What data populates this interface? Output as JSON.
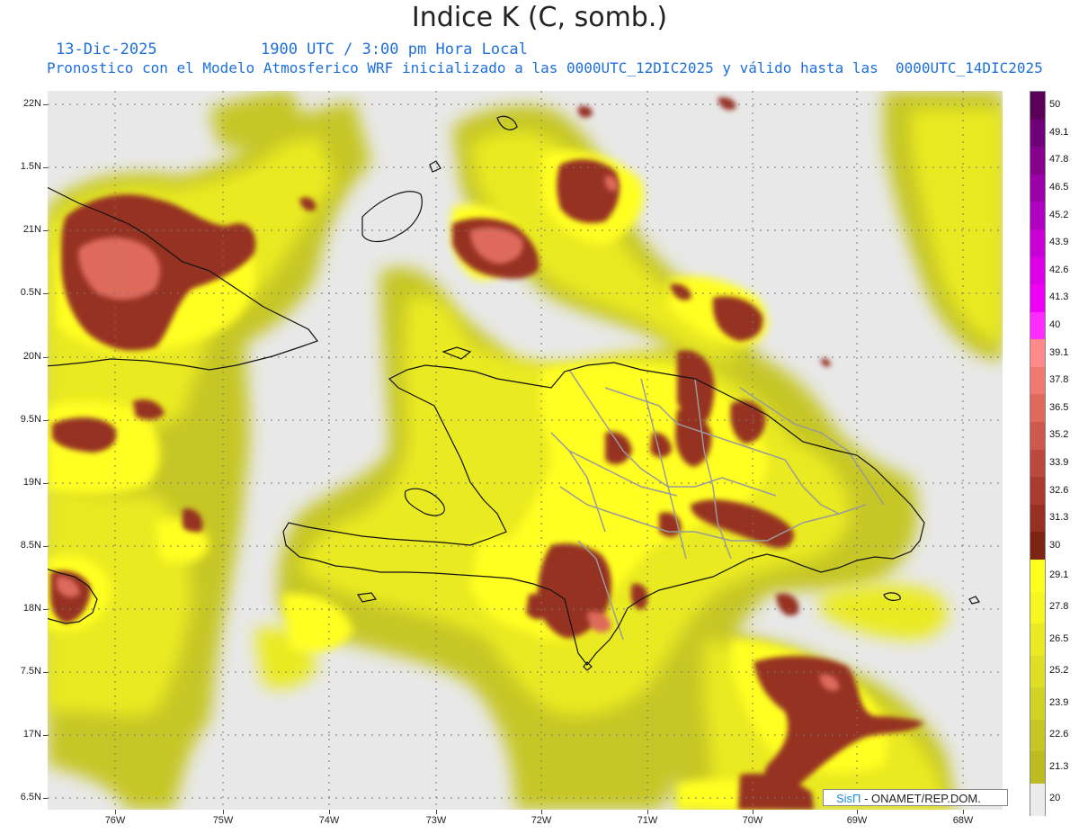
{
  "title": "Indice K (C, somb.)",
  "date": "13-Dic-2025",
  "time": "1900 UTC / 3:00 pm Hora Local",
  "description": "Pronostico con el Modelo Atmosferico WRF inicializado a las 0000UTC_12DIC2025 y válido hasta las  0000UTC_14DIC2025",
  "credit": {
    "brand": "SisΠ",
    "rest": " - ONAMET/REP.DOM."
  },
  "latitude_labels": [
    "22N",
    "1.5N",
    "21N",
    "0.5N",
    "20N",
    "9.5N",
    "19N",
    "8.5N",
    "18N",
    "7.5N",
    "17N",
    "6.5N"
  ],
  "longitude_labels": [
    "76W",
    "75W",
    "74W",
    "73W",
    "72W",
    "71W",
    "70W",
    "69W",
    "68W"
  ],
  "colorbar": {
    "labels": [
      "50",
      "49.1",
      "47.8",
      "46.5",
      "45.2",
      "43.9",
      "42.6",
      "41.3",
      "40",
      "39.1",
      "37.8",
      "36.5",
      "35.2",
      "33.9",
      "32.6",
      "31.3",
      "30",
      "29.1",
      "27.8",
      "26.5",
      "25.2",
      "23.9",
      "22.6",
      "21.3",
      "20"
    ],
    "colors": [
      "#5a005a",
      "#6e0078",
      "#86008e",
      "#9a00a8",
      "#b000c0",
      "#c800d6",
      "#dc00e8",
      "#ee00f4",
      "#ff2cff",
      "#ff8a8a",
      "#ee7a70",
      "#de6a5c",
      "#cc5a4c",
      "#ba4a3e",
      "#a83c30",
      "#963024",
      "#7e2414",
      "#ffff22",
      "#f6f622",
      "#eaea24",
      "#dede26",
      "#d2d226",
      "#c6c626",
      "#bcbc22",
      "#ececec"
    ]
  },
  "colors": {
    "background": "#e8e8e8",
    "k_low": "#bcbc22",
    "k_mid": "#eaea24",
    "k_high": "#ffff22",
    "k_red_dark": "#963024",
    "k_red": "#a83c30",
    "k_red_light": "#de6a5c",
    "coast": "#111111",
    "provinces": "#9a9a9a"
  }
}
